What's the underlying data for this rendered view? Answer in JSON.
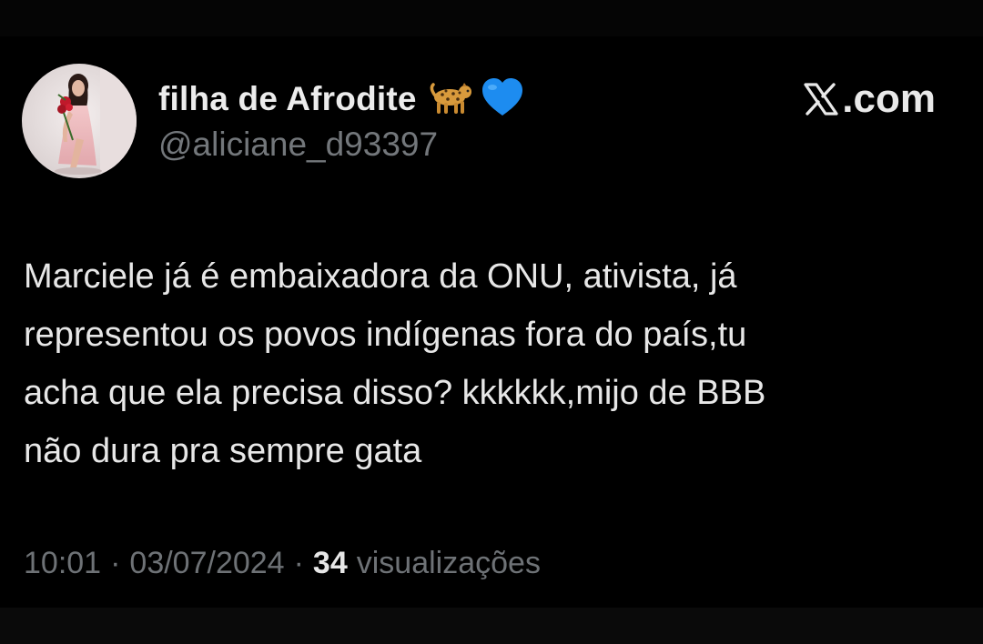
{
  "post": {
    "display_name": "filha de Afrodite",
    "name_emojis": [
      "leopard-icon",
      "blue-heart-icon"
    ],
    "handle": "@aliciane_d93397",
    "text": "Marciele já é embaixadora da ONU, ativista, já\nrepresentou os povos indígenas fora do país,tu\nacha que ela precisa disso? kkkkkk,mijo de BBB\nnão dura pra sempre gata",
    "time": "10:01",
    "separator": "·",
    "date": "03/07/2024",
    "views_count": "34",
    "views_label": "visualizações"
  },
  "brand": {
    "suffix": ".com",
    "icon": "x-logo-icon"
  },
  "colors": {
    "background": "#000000",
    "primary_text": "#e7e7e7",
    "secondary_text": "#71767b",
    "heart": "#1d8cf0"
  }
}
